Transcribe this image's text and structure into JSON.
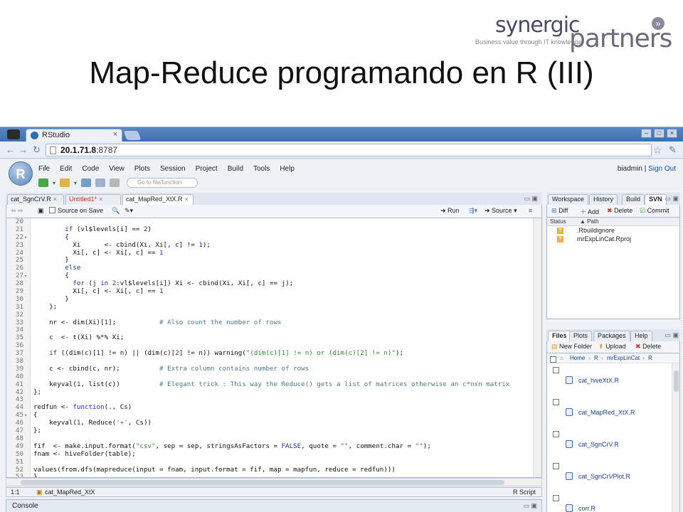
{
  "slide": {
    "title": "Map-Reduce programando en R (III)",
    "logo_top": "synergic",
    "logo_bottom": "partners",
    "logo_tagline": "Business value through IT knowledge"
  },
  "browser": {
    "tab_title": "RStudio",
    "url_host": "20.1.71.8",
    "url_port": ":8787"
  },
  "rstudio": {
    "menu": [
      "File",
      "Edit",
      "Code",
      "View",
      "Plots",
      "Session",
      "Project",
      "Build",
      "Tools",
      "Help"
    ],
    "user": "biadmin",
    "sign_out": "Sign Out",
    "goto_placeholder": "Go to file/function",
    "editor_tabs": [
      "cat_SgnCrV.R",
      "Untitled1*",
      "cat_MapRed_XtX.R"
    ],
    "source_on_save": "Source on Save",
    "run": "Run",
    "source": "Source",
    "status_pos": "1:1",
    "status_file": "cat_MapRed_XtX",
    "status_type": "R Script",
    "console": "Console",
    "code_lines": [
      {
        "n": "20",
        "f": "",
        "t": ""
      },
      {
        "n": "21",
        "f": "",
        "t": "        if (vl$levels[i] == 2)"
      },
      {
        "n": "22",
        "f": "▾",
        "t": "        {"
      },
      {
        "n": "23",
        "f": "",
        "t": "          Xi      <- cbind(Xi, Xi[, c] != 1);"
      },
      {
        "n": "24",
        "f": "",
        "t": "          Xi[, c] <- Xi[, c] == 1"
      },
      {
        "n": "25",
        "f": "",
        "t": "        }"
      },
      {
        "n": "26",
        "f": "",
        "t": "        else"
      },
      {
        "n": "27",
        "f": "▾",
        "t": "        {"
      },
      {
        "n": "28",
        "f": "",
        "t": "          for (j in 2:vl$levels[i]) Xi <- cbind(Xi, Xi[, c] == j);"
      },
      {
        "n": "29",
        "f": "",
        "t": "          Xi[, c] <- Xi[, c] == 1"
      },
      {
        "n": "30",
        "f": "",
        "t": "        }"
      },
      {
        "n": "31",
        "f": "",
        "t": "    };"
      },
      {
        "n": "32",
        "f": "",
        "t": ""
      },
      {
        "n": "33",
        "f": "",
        "t": "    nr <- dim(Xi)[1];           # Also count the number of rows"
      },
      {
        "n": "34",
        "f": "",
        "t": ""
      },
      {
        "n": "35",
        "f": "",
        "t": "    c  <- t(Xi) %*% Xi;"
      },
      {
        "n": "36",
        "f": "",
        "t": ""
      },
      {
        "n": "37",
        "f": "",
        "t": "    if ((dim(c)[1] != n) || (dim(c)[2] != n)) warning(\"(dim(c)[1] != n) or (dim(c)[2] != n)\");"
      },
      {
        "n": "38",
        "f": "",
        "t": ""
      },
      {
        "n": "39",
        "f": "",
        "t": "    c <- cbind(c, nr);          # Extra column contains number of rows"
      },
      {
        "n": "40",
        "f": "",
        "t": ""
      },
      {
        "n": "41",
        "f": "",
        "t": "    keyval(1, list(c))          # Elegant trick : This way the Reduce() gets a list of matrices otherwise an c*nxn matrix"
      },
      {
        "n": "42",
        "f": "",
        "t": "};"
      },
      {
        "n": "43",
        "f": "",
        "t": ""
      },
      {
        "n": "44",
        "f": "",
        "t": "redfun <- function(., Cs)"
      },
      {
        "n": "45",
        "f": "▾",
        "t": "{"
      },
      {
        "n": "46",
        "f": "",
        "t": "    keyval(1, Reduce('+', Cs))"
      },
      {
        "n": "47",
        "f": "",
        "t": "};"
      },
      {
        "n": "48",
        "f": "",
        "t": ""
      },
      {
        "n": "49",
        "f": "",
        "t": "fif  <- make.input.format(\"csv\", sep = sep, stringsAsFactors = FALSE, quote = \"\", comment.char = \"\");"
      },
      {
        "n": "50",
        "f": "",
        "t": "fnam <- hiveFolder(table);"
      },
      {
        "n": "51",
        "f": "",
        "t": ""
      },
      {
        "n": "52",
        "f": "",
        "t": "values(from.dfs(mapreduce(input = fnam, input.format = fif, map = mapfun, reduce = redfun)))"
      },
      {
        "n": "53",
        "f": "",
        "t": "}"
      },
      {
        "n": "54",
        "f": "",
        "t": ""
      }
    ],
    "upper_right_tabs": [
      "Workspace",
      "History",
      "Build",
      "SVN"
    ],
    "svn_actions": [
      "Diff",
      "Add",
      "Delete",
      "Commit"
    ],
    "svn_headers": [
      "Status",
      "Path"
    ],
    "svn_files": [
      ".Rbuildignore",
      "mrExpLinCat.Rproj"
    ],
    "svn_status": "?",
    "lower_right_tabs": [
      "Files",
      "Plots",
      "Packages",
      "Help"
    ],
    "files_actions": [
      "New Folder",
      "Upload",
      "Delete"
    ],
    "breadcrumb": [
      "Home",
      "R",
      "mrExpLinCat",
      "R"
    ],
    "files": [
      "cat_hiveXtX.R",
      "cat_MapRed_XtX.R",
      "cat_SgnCrV.R",
      "cat_SgnCrVPlot.R",
      "corr.R"
    ],
    "project_label": "mrExpLinCat"
  }
}
